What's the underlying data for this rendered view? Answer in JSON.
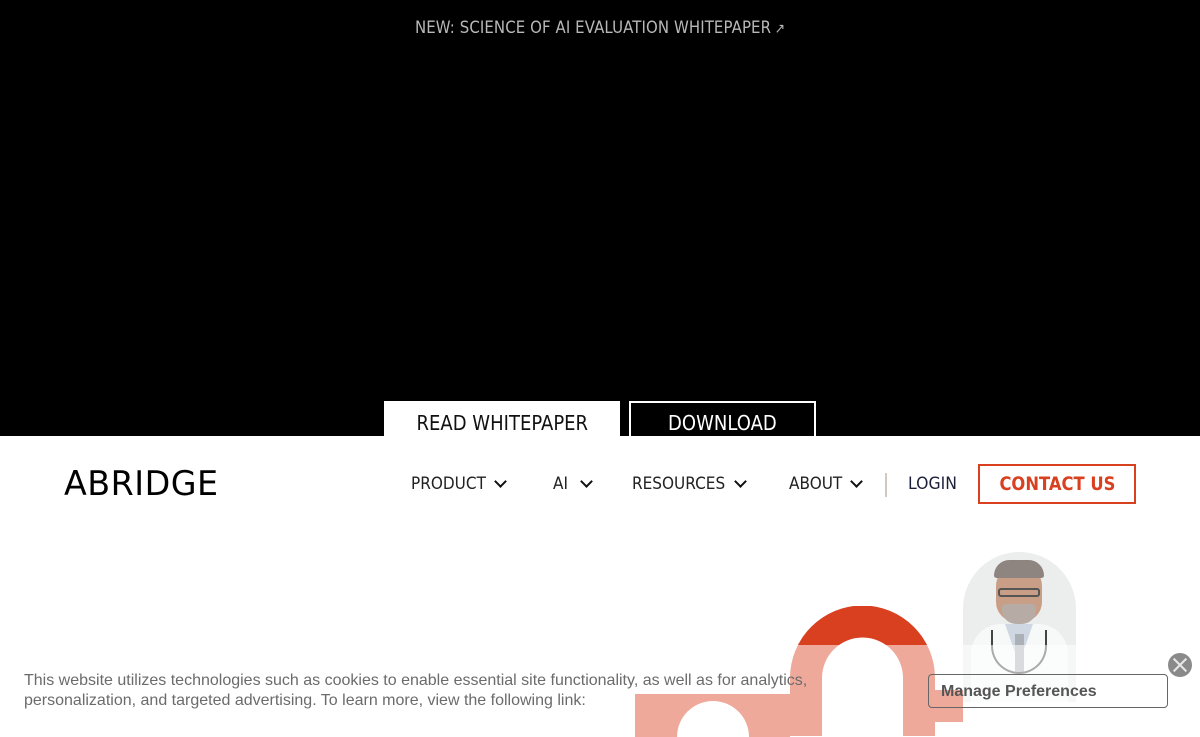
{
  "hero": {
    "banner_text": "NEW: SCIENCE OF AI EVALUATION WHITEPAPER",
    "banner_icon": "arrow-up-right-icon",
    "banner_arrow": "↗",
    "read_button": "READ WHITEPAPER",
    "download_button": "DOWNLOAD"
  },
  "nav": {
    "logo": "ABRIDGE",
    "items": [
      {
        "label": "PRODUCT",
        "icon": "chevron-down-icon"
      },
      {
        "label": "AI",
        "icon": "chevron-down-icon"
      },
      {
        "label": "RESOURCES",
        "icon": "chevron-down-icon"
      },
      {
        "label": "ABOUT",
        "icon": "chevron-down-icon"
      }
    ],
    "login": "LOGIN",
    "contact": "CONTACT US"
  },
  "colors": {
    "accent": "#d9401f",
    "accent_light": "#e9a896",
    "hero_bg": "#000000"
  },
  "hero_image": {
    "alt": "doctor-portrait"
  },
  "cookie": {
    "text": "This website utilizes technologies such as cookies to enable essential site functionality, as well as for analytics, personalization, and targeted advertising. To learn more, view the following link:",
    "manage_button": "Manage Preferences",
    "close_icon": "close-icon"
  }
}
